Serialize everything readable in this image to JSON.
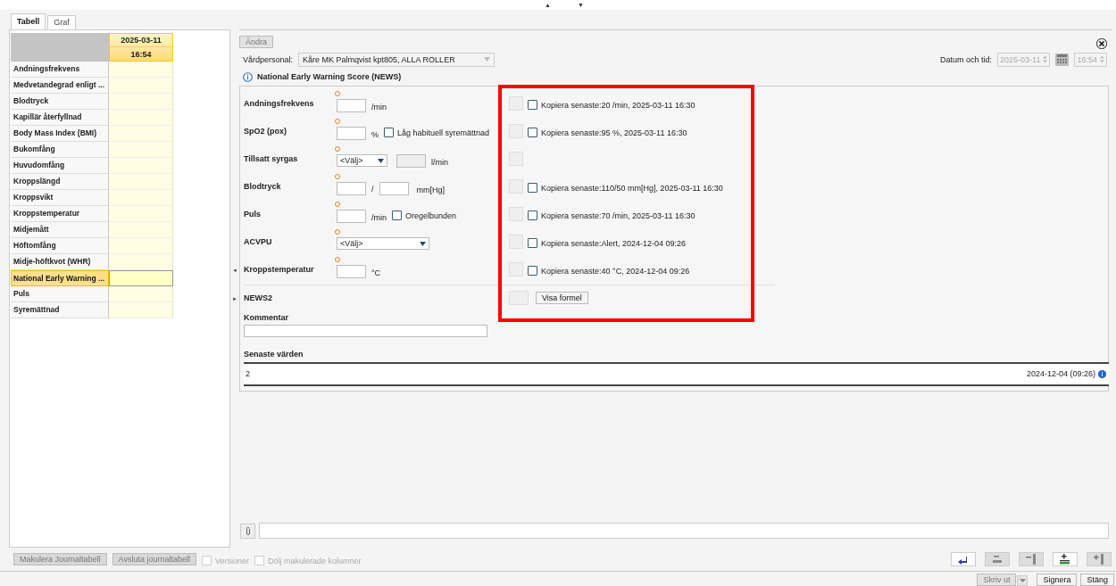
{
  "top_arrows": [
    "▲",
    "▼"
  ],
  "tabs": [
    {
      "label": "Tabell",
      "selected": true
    },
    {
      "label": "Graf",
      "selected": false
    }
  ],
  "table": {
    "date": "2025-03-11",
    "time": "16:54",
    "rows": [
      {
        "label": "Andningsfrekvens",
        "selected": false
      },
      {
        "label": "Medvetandegrad enligt ...",
        "selected": false
      },
      {
        "label": "Blodtryck",
        "selected": false
      },
      {
        "label": "Kapillär återfyllnad",
        "selected": false
      },
      {
        "label": "Body Mass Index (BMI)",
        "selected": false
      },
      {
        "label": "Bukomfång",
        "selected": false
      },
      {
        "label": "Huvudomfång",
        "selected": false
      },
      {
        "label": "Kroppslängd",
        "selected": false
      },
      {
        "label": "Kroppsvikt",
        "selected": false
      },
      {
        "label": "Kroppstemperatur",
        "selected": false
      },
      {
        "label": "Midjemått",
        "selected": false
      },
      {
        "label": "Höftomfång",
        "selected": false
      },
      {
        "label": "Midje-höftkvot (WHR)",
        "selected": false
      },
      {
        "label": "National Early Warning ...",
        "selected": true
      },
      {
        "label": "Puls",
        "selected": false
      },
      {
        "label": "Syremättnad",
        "selected": false
      }
    ]
  },
  "splitter_arrows": [
    "◄",
    "►"
  ],
  "edit_button": {
    "label": "Ändra",
    "disabled": true
  },
  "staff": {
    "label": "Vårdpersonal:",
    "value": "Kåre MK Palmqvist kpt805, ALLA ROLLER"
  },
  "datetime": {
    "label": "Datum och tid:",
    "date": "2025-03-11",
    "time": "16:54"
  },
  "form": {
    "title": "National Early Warning Score (NEWS)",
    "rows": [
      {
        "kind": "number",
        "label": "Andningsfrekvens",
        "unit": "/min",
        "copy": {
          "text": "Kopiera senaste:20 /min, 2025-03-11 16:30",
          "checked": false
        }
      },
      {
        "kind": "number",
        "label": "SpO2 (pox)",
        "unit": "%",
        "option": {
          "label": "Låg habituell syremättnad",
          "checked": false
        },
        "copy": {
          "text": "Kopiera senaste:95 %, 2025-03-11 16:30",
          "checked": false
        }
      },
      {
        "kind": "select_rate",
        "label": "Tillsatt syrgas",
        "select": "<Välj>",
        "unit": "l/min"
      },
      {
        "kind": "pressure",
        "label": "Blodtryck",
        "separator": "/",
        "unit": "mm[Hg]",
        "copy": {
          "text": "Kopiera senaste:110/50 mm[Hg], 2025-03-11 16:30",
          "checked": false
        }
      },
      {
        "kind": "number",
        "label": "Puls",
        "unit": "/min",
        "option": {
          "label": "Oregelbunden",
          "checked": false
        },
        "copy": {
          "text": "Kopiera senaste:70 /min, 2025-03-11 16:30",
          "checked": false
        }
      },
      {
        "kind": "select",
        "label": "ACVPU",
        "select": "<Välj>",
        "copy": {
          "text": "Kopiera senaste:Alert, 2024-12-04 09:26",
          "checked": false
        }
      },
      {
        "kind": "number",
        "label": "Kroppstemperatur",
        "unit": "°C",
        "copy": {
          "text": "Kopiera senaste:40 °C, 2024-12-04 09:26",
          "checked": false
        }
      }
    ],
    "news2": {
      "label": "NEWS2",
      "button": "Visa formel"
    },
    "comment_label": "Kommentar",
    "latest": {
      "label": "Senaste värden",
      "value": "2",
      "date": "2024-12-04 (09:26)"
    }
  },
  "bottom_buttons": [
    {
      "label": "Makulera Journaltabell",
      "disabled": true
    },
    {
      "label": "Avsluta journaltabell",
      "disabled": true
    }
  ],
  "bottom_checkboxes": [
    {
      "label": "Versioner",
      "checked": false,
      "disabled": true
    },
    {
      "label": "Dölj makulerade kolumner",
      "checked": false,
      "disabled": true
    }
  ],
  "footer_buttons": [
    {
      "label": "Skriv ut",
      "disabled": true
    },
    {
      "label": "Signera",
      "disabled": false
    },
    {
      "label": "Stäng",
      "disabled": false
    }
  ]
}
